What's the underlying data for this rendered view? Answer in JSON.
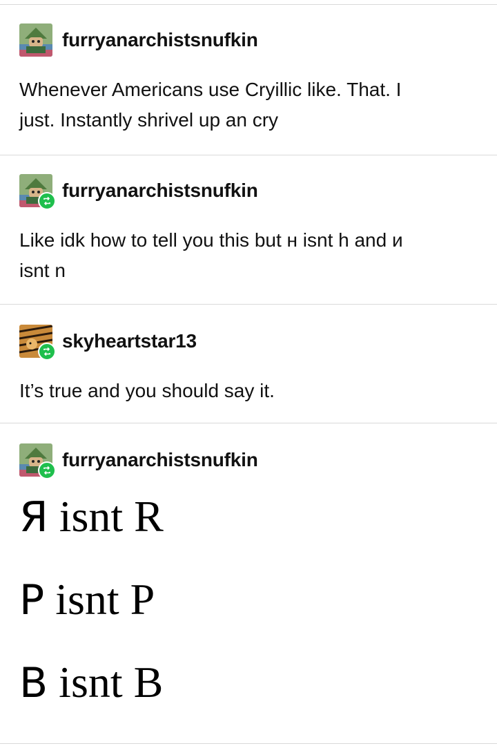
{
  "posts": [
    {
      "username": "furryanarchistsnufkin",
      "is_reblog": false,
      "lines": [
        "Whenever Americans use Cryillic like. That. I",
        "just. Instantly shrivel up an cry"
      ]
    },
    {
      "username": "furryanarchistsnufkin",
      "is_reblog": true,
      "lines": [
        "Like idk how to tell you this but н isnt h and и",
        "isnt n"
      ]
    },
    {
      "username": "skyheartstar13",
      "is_reblog": true,
      "lines": [
        "It’s true and you should say it."
      ]
    },
    {
      "username": "furryanarchistsnufkin",
      "is_reblog": true,
      "big_lines": [
        {
          "cyrillic": "Я",
          "rest": " isnt R"
        },
        {
          "cyrillic": "Р",
          "rest": " isnt P"
        },
        {
          "cyrillic": "В",
          "rest": " isnt B"
        }
      ]
    }
  ],
  "colors": {
    "reblog_badge": "#1fbf4d",
    "divider": "#d9d9d9",
    "text": "#111111"
  },
  "icons": {
    "reblog": "reblog-icon",
    "avatar_snufkin": "snufkin-avatar",
    "avatar_tiger": "tiger-avatar"
  }
}
